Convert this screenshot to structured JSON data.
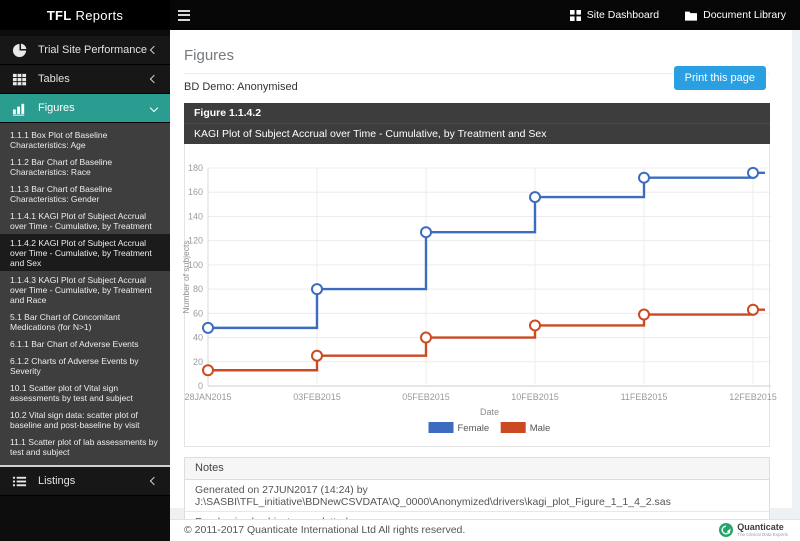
{
  "topbar": {
    "menu_icon": "hamburger-icon",
    "links": [
      {
        "label": "Site Dashboard",
        "icon": "grid-icon"
      },
      {
        "label": "Document Library",
        "icon": "folder-icon"
      }
    ]
  },
  "sidebar": {
    "brand": {
      "bold": "TFL",
      "rest": "Reports"
    },
    "items": [
      {
        "label": "Trial Site Performance",
        "icon": "pie-chart-icon",
        "state": "collapsed"
      },
      {
        "label": "Tables",
        "icon": "table-icon",
        "state": "collapsed"
      },
      {
        "label": "Figures",
        "icon": "bar-chart-icon",
        "state": "expanded",
        "active": true
      },
      {
        "label": "Listings",
        "icon": "list-icon",
        "state": "collapsed"
      }
    ],
    "figures_submenu": [
      {
        "label": "1.1.1 Box Plot of Baseline Characteristics: Age",
        "selected": false
      },
      {
        "label": "1.1.2 Bar Chart of Baseline Characteristics: Race",
        "selected": false
      },
      {
        "label": "1.1.3 Bar Chart of Baseline Characteristics: Gender",
        "selected": false
      },
      {
        "label": "1.1.4.1 KAGI Plot of Subject Accrual over Time - Cumulative, by Treatment",
        "selected": false
      },
      {
        "label": "1.1.4.2 KAGI Plot of Subject Accrual over Time - Cumulative, by Treatment and Sex",
        "selected": true
      },
      {
        "label": "1.1.4.3 KAGI Plot of Subject Accrual over Time - Cumulative, by Treatment and Race",
        "selected": false
      },
      {
        "label": "5.1 Bar Chart of Concomitant Medications (for N>1)",
        "selected": false
      },
      {
        "label": "6.1.1 Bar Chart of Adverse Events",
        "selected": false
      },
      {
        "label": "6.1.2 Charts of Adverse Events by Severity",
        "selected": false
      },
      {
        "label": "10.1 Scatter plot of Vital sign assessments by test and subject",
        "selected": false
      },
      {
        "label": "10.2 Vital sign data: scatter plot of baseline and post-baseline by visit",
        "selected": false
      },
      {
        "label": "11.1 Scatter plot of lab assessments by test and subject",
        "selected": false
      }
    ]
  },
  "header": {
    "page_title": "Figures",
    "subtitle": "BD Demo: Anonymised",
    "print_button": "Print this page"
  },
  "figure_panel": {
    "number": "Figure 1.1.4.2",
    "title": "KAGI Plot of Subject Accrual over Time - Cumulative, by Treatment and Sex"
  },
  "chart_data": {
    "type": "line",
    "subtype": "step",
    "categories": [
      "28JAN2015",
      "03FEB2015",
      "05FEB2015",
      "10FEB2015",
      "11FEB2015",
      "12FEB2015"
    ],
    "series": [
      {
        "name": "Female",
        "color": "#3b6cc0",
        "values": [
          48,
          80,
          127,
          156,
          172,
          176
        ]
      },
      {
        "name": "Male",
        "color": "#cc4a22",
        "values": [
          13,
          25,
          40,
          50,
          59,
          63
        ]
      }
    ],
    "title": "",
    "xlabel": "Date",
    "ylabel": "Number of subjects",
    "ylim": [
      0,
      180
    ],
    "ytick_step": 20,
    "grid": true,
    "legend_position": "bottom",
    "marker": "open-circle"
  },
  "notes": {
    "header": "Notes",
    "rows": [
      "Generated on 27JUN2017 (14:24) by J:\\SASBI\\TFL_initiative\\BDNewCSVDATA\\Q_0000\\Anonymized\\drivers\\kagi_plot_Figure_1_1_4_2.sas",
      "Randomised subjects are plotted."
    ]
  },
  "footer": {
    "copyright": "© 2011-2017 Quanticate International Ltd All rights reserved.",
    "logo_text": "Quanticate",
    "logo_tagline": "The Clinical Data Experts",
    "logo_color": "#27a46a"
  }
}
